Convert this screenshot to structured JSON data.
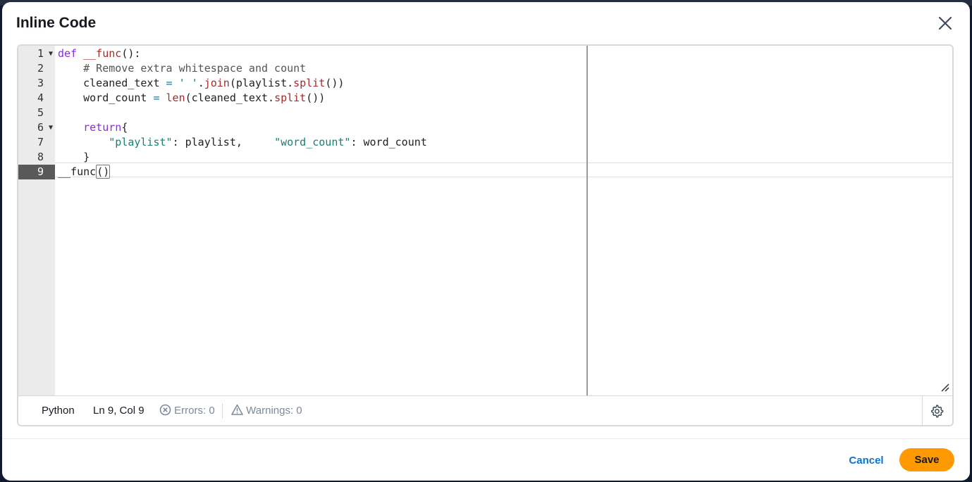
{
  "modal": {
    "title": "Inline Code"
  },
  "editor": {
    "line_numbers": [
      "1",
      "2",
      "3",
      "4",
      "5",
      "6",
      "7",
      "8",
      "9"
    ],
    "lines": [
      [
        {
          "t": "def",
          "c": "kw"
        },
        {
          "t": " "
        },
        {
          "t": "__func",
          "c": "fn"
        },
        {
          "t": "():"
        }
      ],
      [
        {
          "t": "    "
        },
        {
          "t": "# Remove extra whitespace and count",
          "c": "comment"
        }
      ],
      [
        {
          "t": "    cleaned_text "
        },
        {
          "t": "=",
          "c": "op"
        },
        {
          "t": " "
        },
        {
          "t": "' '",
          "c": "str"
        },
        {
          "t": "."
        },
        {
          "t": "join",
          "c": "fn"
        },
        {
          "t": "(playlist."
        },
        {
          "t": "split",
          "c": "fn"
        },
        {
          "t": "())"
        }
      ],
      [
        {
          "t": "    word_count "
        },
        {
          "t": "=",
          "c": "op"
        },
        {
          "t": " "
        },
        {
          "t": "len",
          "c": "fn"
        },
        {
          "t": "(cleaned_text."
        },
        {
          "t": "split",
          "c": "fn"
        },
        {
          "t": "())"
        }
      ],
      [
        {
          "t": ""
        }
      ],
      [
        {
          "t": "    "
        },
        {
          "t": "return",
          "c": "kw"
        },
        {
          "t": "{"
        }
      ],
      [
        {
          "t": "        "
        },
        {
          "t": "\"playlist\"",
          "c": "str"
        },
        {
          "t": ": playlist,     "
        },
        {
          "t": "\"word_count\"",
          "c": "str"
        },
        {
          "t": ": word_count"
        }
      ],
      [
        {
          "t": "    }"
        }
      ],
      [
        {
          "t": "__func"
        },
        {
          "t": "()",
          "c": "bracket-box"
        }
      ]
    ]
  },
  "status": {
    "language": "Python",
    "cursor": "Ln 9, Col 9",
    "errors": "Errors: 0",
    "warnings": "Warnings: 0"
  },
  "footer": {
    "cancel_label": "Cancel",
    "save_label": "Save"
  },
  "colors": {
    "primary_button": "#ff9900",
    "link": "#0972d3"
  }
}
